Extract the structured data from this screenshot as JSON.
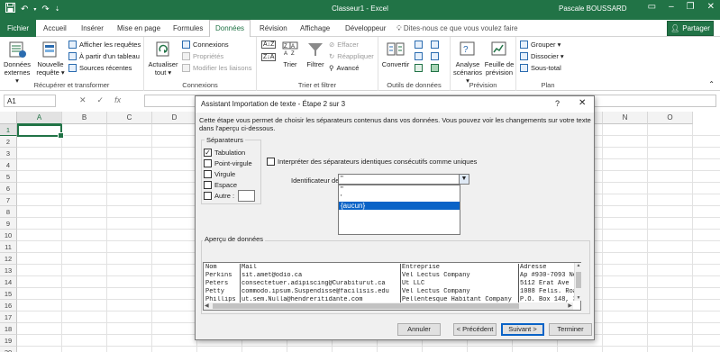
{
  "window": {
    "title": "Classeur1 - Excel",
    "user": "Pascale BOUSSARD"
  },
  "qat": {
    "save_icon": "save-icon",
    "undo_icon": "undo-icon",
    "redo_icon": "redo-icon"
  },
  "tabs": {
    "file": "Fichier",
    "items": [
      "Accueil",
      "Insérer",
      "Mise en page",
      "Formules",
      "Données",
      "Révision",
      "Affichage",
      "Développeur"
    ],
    "active": "Données",
    "tell_me": "Dites-nous ce que vous voulez faire",
    "share": "Partager"
  },
  "ribbon": {
    "get_transform": {
      "label": "Récupérer et transformer",
      "external_data": "Données externes ▾",
      "new_query": "Nouvelle requête ▾",
      "show_queries": "Afficher les requêtes",
      "from_table": "À partir d'un tableau",
      "recent_sources": "Sources récentes"
    },
    "connections": {
      "label": "Connexions",
      "refresh_all": "Actualiser tout ▾",
      "connections": "Connexions",
      "properties": "Propriétés",
      "edit_links": "Modifier les liaisons"
    },
    "sort_filter": {
      "label": "Trier et filtrer",
      "sort": "Trier",
      "filter": "Filtrer",
      "clear": "Effacer",
      "reapply": "Réappliquer",
      "advanced": "Avancé"
    },
    "data_tools": {
      "label": "Outils de données",
      "convert": "Convertir"
    },
    "forecast": {
      "label": "Prévision",
      "what_if": "Analyse scénarios ▾",
      "forecast_sheet": "Feuille de prévision"
    },
    "outline": {
      "label": "Plan",
      "group": "Grouper ▾",
      "ungroup": "Dissocier ▾",
      "subtotal": "Sous-total"
    }
  },
  "formula_bar": {
    "name_box": "A1",
    "cancel": "✕",
    "enter": "✓",
    "fx": "fx",
    "value": ""
  },
  "sheet": {
    "columns": [
      "A",
      "B",
      "C",
      "D",
      "E",
      "F",
      "G",
      "H",
      "I",
      "J",
      "K",
      "L",
      "M",
      "N",
      "O"
    ],
    "rows": [
      "1",
      "2",
      "3",
      "4",
      "5",
      "6",
      "7",
      "8",
      "9",
      "10",
      "11",
      "12",
      "13",
      "14",
      "15",
      "16",
      "17",
      "18",
      "19",
      "20"
    ],
    "selected": "A1"
  },
  "dialog": {
    "title": "Assistant Importation de texte - Étape 2 sur 3",
    "help": "?",
    "close": "✕",
    "description": "Cette étape vous permet de choisir les séparateurs contenus dans vos données. Vous pouvez voir les changements sur votre texte dans l'aperçu ci-dessous.",
    "separators": {
      "legend": "Séparateurs",
      "tab": {
        "label": "Tabulation",
        "checked": true
      },
      "semicolon": {
        "label": "Point-virgule",
        "checked": false
      },
      "comma": {
        "label": "Virgule",
        "checked": false
      },
      "space": {
        "label": "Espace",
        "checked": false
      },
      "other": {
        "label": "Autre :",
        "checked": false,
        "value": ""
      }
    },
    "consecutive": {
      "label": "Interpréter des séparateurs identiques consécutifs comme uniques",
      "checked": false
    },
    "text_qualifier": {
      "label": "Identificateur de texte :",
      "value": "\"",
      "options": [
        "\"",
        "'",
        "{aucun}"
      ],
      "highlighted": "{aucun}"
    },
    "preview": {
      "label": "Aperçu de données",
      "rows": [
        [
          "Nom",
          "Mail",
          "Entreprise",
          "Adresse"
        ],
        [
          "Perkins",
          "sit.amet@odio.ca",
          "Vel Lectus Company",
          "Ap #930-7093 Ne"
        ],
        [
          "Peters",
          "consectetuer.adipiscing@Curabiturut.ca",
          "Ut LLC",
          "5112 Erat Ave"
        ],
        [
          "Petty",
          "commodo.ipsum.Suspendisse@facilisis.edu",
          "Vel Lectus Company",
          "1088 Felis. Roa"
        ],
        [
          "Phillips",
          "ut.sem.Nulla@hendreritidante.com",
          "Pellentesque Habitant Company",
          "P.O. Box 148, 3"
        ]
      ]
    },
    "buttons": {
      "cancel": "Annuler",
      "previous": "< Précédent",
      "next": "Suivant >",
      "finish": "Terminer"
    }
  },
  "colors": {
    "excel_green": "#217346",
    "highlight_blue": "#0a63c7"
  }
}
